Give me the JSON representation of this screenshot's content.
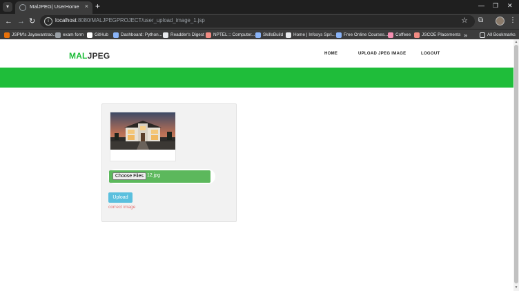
{
  "browser": {
    "tab_title": "MalJPEG| UserHome",
    "url_host": "localhost",
    "url_rest": ":8080/MALJPEGPROJECT/user_upload_image_1.jsp",
    "bookmarks": [
      {
        "label": "JSPM's Jayawantrao...",
        "color": "#e8710a"
      },
      {
        "label": "exam form",
        "color": "#9aa0a6"
      },
      {
        "label": "GitHub",
        "color": "#ffffff"
      },
      {
        "label": "Dashboard: Python...",
        "color": "#8ab4f8"
      },
      {
        "label": "Readder's Digest",
        "color": "#e8eaed"
      },
      {
        "label": "NPTEL :: Computer...",
        "color": "#f28b82"
      },
      {
        "label": "SkillsBuild",
        "color": "#8ab4f8"
      },
      {
        "label": "Home | Infosys Spri...",
        "color": "#e8eaed"
      },
      {
        "label": "Free Online Courses...",
        "color": "#8ab4f8"
      },
      {
        "label": "Coffeee",
        "color": "#f48fb1"
      },
      {
        "label": "JSCOE Placements",
        "color": "#f28b82"
      }
    ],
    "all_bookmarks": "All Bookmarks"
  },
  "site": {
    "brand_part1": "MAL",
    "brand_part2": "JPEG",
    "nav": [
      "HOME",
      "UPLOAD JPEG IMAGE",
      "LOGOUT"
    ],
    "accent_color": "#1fbd3a"
  },
  "upload": {
    "choose_label": "Choose Files",
    "file_name": "12.jpg",
    "button_label": "Upload",
    "status_message": "correct image"
  }
}
